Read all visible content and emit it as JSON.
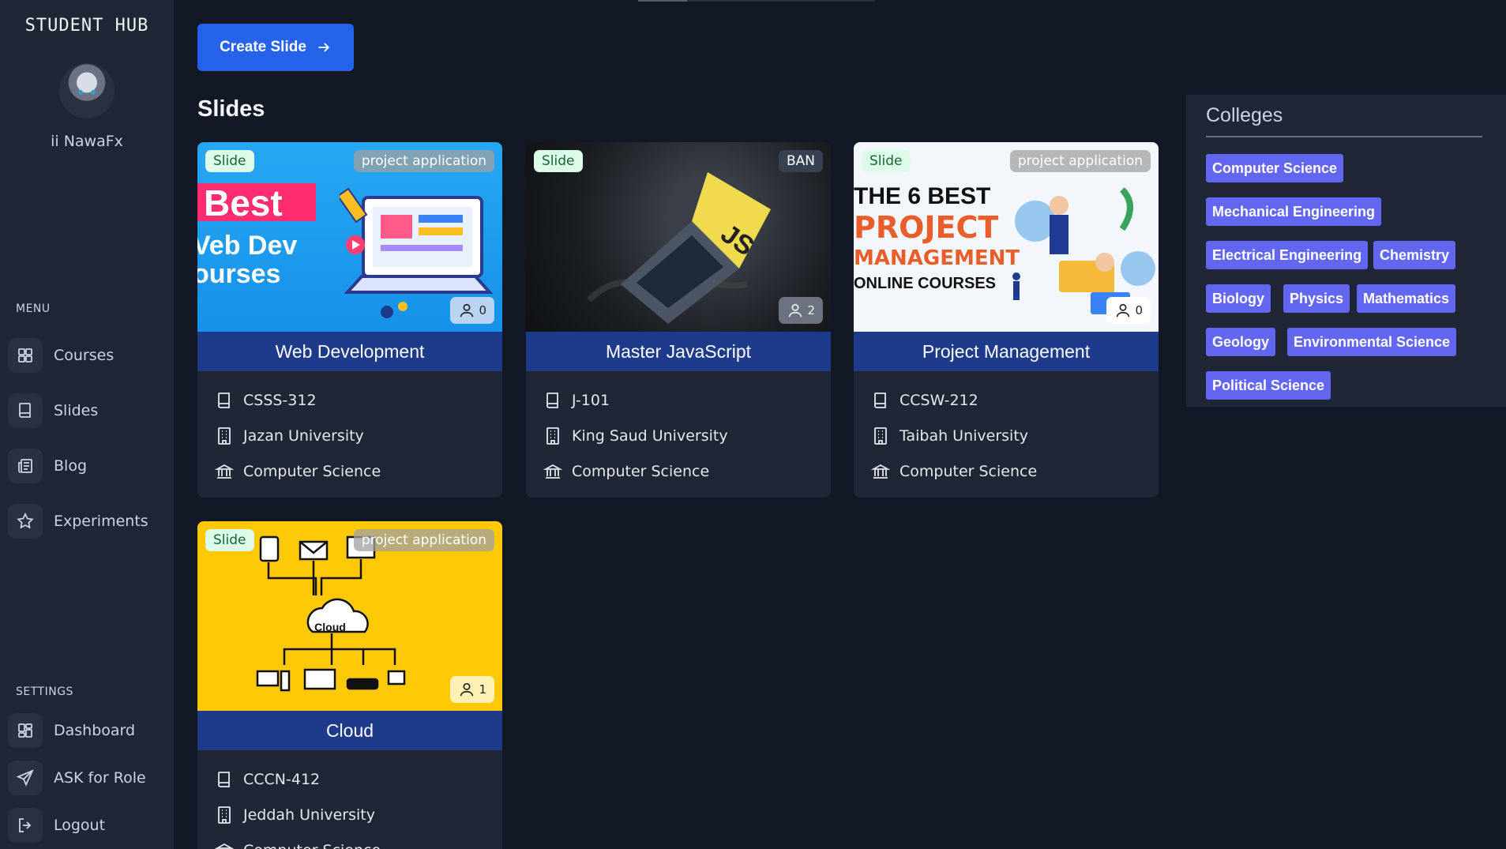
{
  "sidebar": {
    "brand": "STUDENT HUB",
    "username": "ii NawaFx",
    "menu_label": "MENU",
    "menu": [
      {
        "label": "Courses",
        "icon": "grid-icon"
      },
      {
        "label": "Slides",
        "icon": "book-icon"
      },
      {
        "label": "Blog",
        "icon": "newspaper-icon"
      },
      {
        "label": "Experiments",
        "icon": "star-icon"
      }
    ],
    "settings_label": "SETTINGS",
    "settings": [
      {
        "label": "Dashboard",
        "icon": "grid-icon"
      },
      {
        "label": "ASK for Role",
        "icon": "send-icon"
      },
      {
        "label": "Logout",
        "icon": "logout-icon"
      }
    ]
  },
  "toolbar": {
    "create_label": "Create Slide"
  },
  "slides_heading": "Slides",
  "cards": [
    {
      "badge": "Slide",
      "tag": "project application",
      "count": "0",
      "title": "Web Development",
      "code": "CSSS-312",
      "university": "Jazan University",
      "college": "Computer Science",
      "art": {
        "line1": "Best",
        "line2": "Veb Dev",
        "line3": "ourses"
      }
    },
    {
      "badge": "Slide",
      "tag": "BAN",
      "count": "2",
      "title": "Master JavaScript",
      "code": "J-101",
      "university": "King Saud University",
      "college": "Computer Science",
      "art": {
        "line1": "JS"
      }
    },
    {
      "badge": "Slide",
      "tag": "project application",
      "count": "0",
      "title": "Project Management",
      "code": "CCSW-212",
      "university": "Taibah University",
      "college": "Computer Science",
      "art": {
        "line1": "THE 6 BEST",
        "line2": "PROJECT",
        "line3": "MANAGEMENT",
        "line4": "ONLINE COURSES"
      }
    },
    {
      "badge": "Slide",
      "tag": "project application",
      "count": "1",
      "title": "Cloud",
      "code": "CCCN-412",
      "university": "Jeddah University",
      "college": "Computer Science",
      "art": {
        "line1": "Cloud"
      }
    }
  ],
  "colleges": {
    "title": "Colleges",
    "items": [
      "Computer Science",
      "Mechanical Engineering",
      "Electrical Engineering",
      "Chemistry",
      "Biology",
      "Physics",
      "Mathematics",
      "Geology",
      "Environmental Science",
      "Political Science"
    ]
  }
}
